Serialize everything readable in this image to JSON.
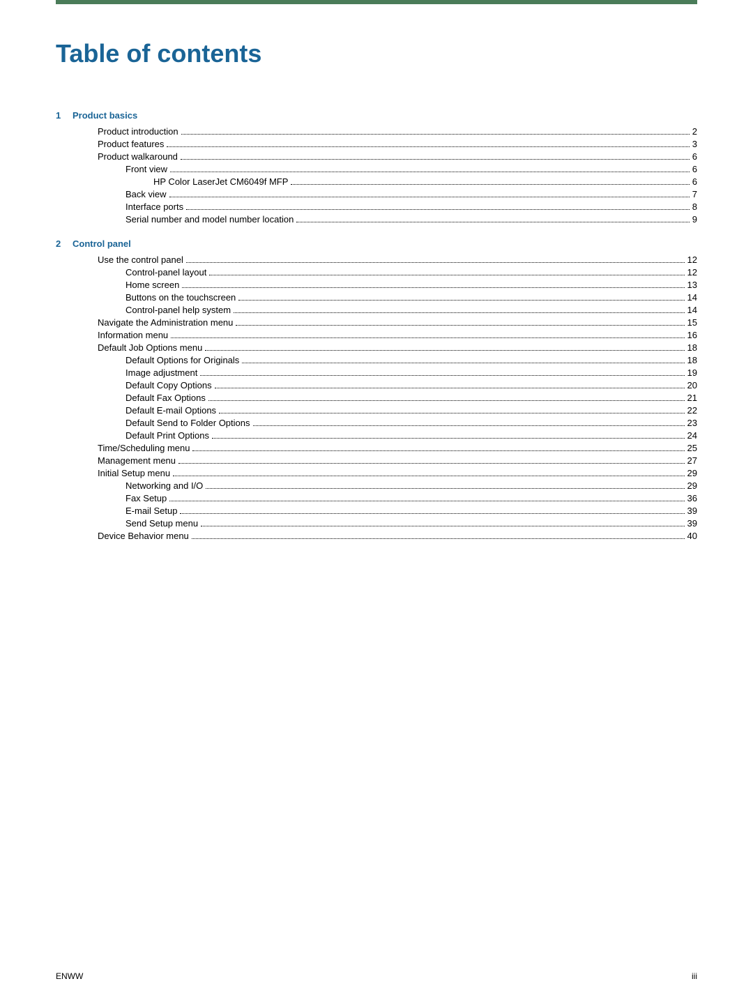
{
  "page": {
    "title": "Table of contents",
    "footer_left": "ENWW",
    "footer_right": "iii"
  },
  "sections": [
    {
      "number": "1",
      "title": "Product basics",
      "entries": [
        {
          "level": 1,
          "text": "Product introduction",
          "page": "2"
        },
        {
          "level": 1,
          "text": "Product features",
          "page": "3"
        },
        {
          "level": 1,
          "text": "Product walkaround",
          "page": "6"
        },
        {
          "level": 2,
          "text": "Front view",
          "page": "6"
        },
        {
          "level": 3,
          "text": "HP Color LaserJet CM6049f MFP",
          "page": "6"
        },
        {
          "level": 2,
          "text": "Back view",
          "page": "7"
        },
        {
          "level": 2,
          "text": "Interface ports",
          "page": "8"
        },
        {
          "level": 2,
          "text": "Serial number and model number location",
          "page": "9"
        }
      ]
    },
    {
      "number": "2",
      "title": "Control panel",
      "entries": [
        {
          "level": 1,
          "text": "Use the control panel",
          "page": "12"
        },
        {
          "level": 2,
          "text": "Control-panel layout",
          "page": "12"
        },
        {
          "level": 2,
          "text": "Home screen",
          "page": "13"
        },
        {
          "level": 2,
          "text": "Buttons on the touchscreen",
          "page": "14"
        },
        {
          "level": 2,
          "text": "Control-panel help system",
          "page": "14"
        },
        {
          "level": 1,
          "text": "Navigate the Administration menu",
          "page": "15"
        },
        {
          "level": 1,
          "text": "Information menu",
          "page": "16"
        },
        {
          "level": 1,
          "text": "Default Job Options menu",
          "page": "18"
        },
        {
          "level": 2,
          "text": "Default Options for Originals",
          "page": "18"
        },
        {
          "level": 2,
          "text": "Image adjustment",
          "page": "19"
        },
        {
          "level": 2,
          "text": "Default Copy Options",
          "page": "20"
        },
        {
          "level": 2,
          "text": "Default Fax Options",
          "page": "21"
        },
        {
          "level": 2,
          "text": "Default E-mail Options",
          "page": "22"
        },
        {
          "level": 2,
          "text": "Default Send to Folder Options",
          "page": "23"
        },
        {
          "level": 2,
          "text": "Default Print Options",
          "page": "24"
        },
        {
          "level": 1,
          "text": "Time/Scheduling menu",
          "page": "25"
        },
        {
          "level": 1,
          "text": "Management menu",
          "page": "27"
        },
        {
          "level": 1,
          "text": "Initial Setup menu",
          "page": "29"
        },
        {
          "level": 2,
          "text": "Networking and I/O",
          "page": "29"
        },
        {
          "level": 2,
          "text": "Fax Setup",
          "page": "36"
        },
        {
          "level": 2,
          "text": "E-mail Setup",
          "page": "39"
        },
        {
          "level": 2,
          "text": "Send Setup menu",
          "page": "39"
        },
        {
          "level": 1,
          "text": "Device Behavior menu",
          "page": "40"
        }
      ]
    }
  ]
}
